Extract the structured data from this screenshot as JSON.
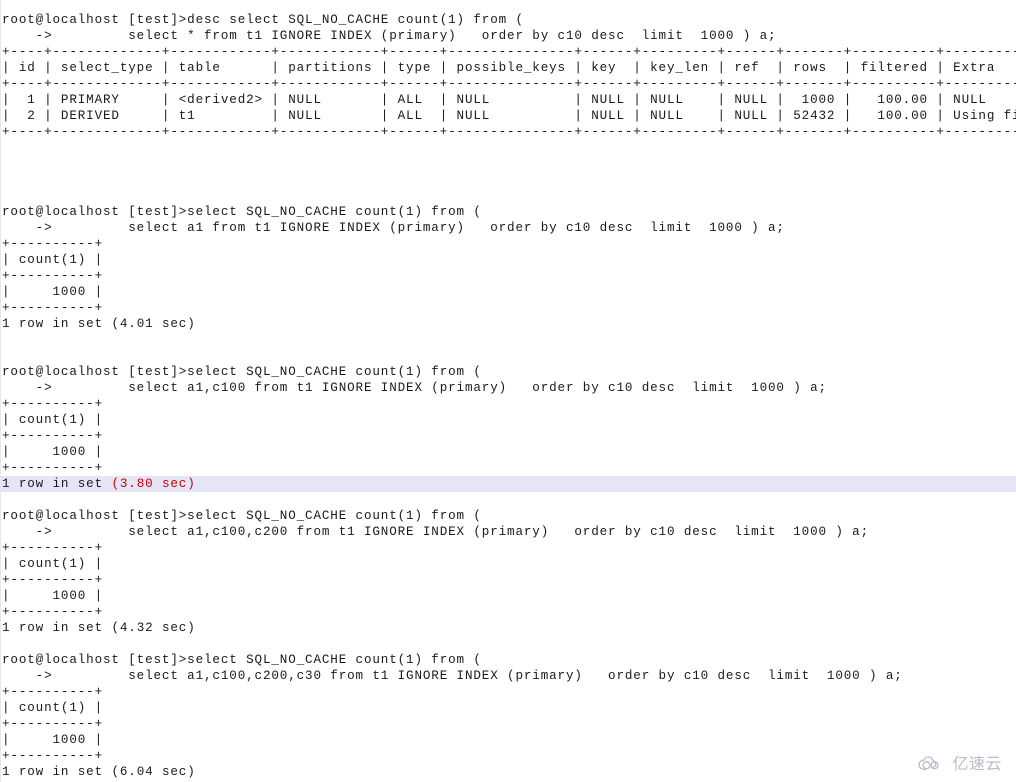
{
  "terminal": {
    "prompt": "root@localhost [test]>",
    "continuation": "    -> ",
    "colors": {
      "background": "#ffffff",
      "foreground": "#1a1a1a",
      "selection": "#e6e4f7",
      "error_red": "#cc0000",
      "watermark": "#8b93a8"
    }
  },
  "blocks": [
    {
      "id": "explain-block",
      "command_line_1": "root@localhost [test]>desc select SQL_NO_CACHE count(1) from (",
      "command_line_2": "    ->         select * from t1 IGNORE INDEX (primary)   order by c10 desc  limit  1000 ) a;",
      "table": {
        "separator": "+----+-------------+------------+------------+------+---------------+------+---------+------+-------+----------+----------------+",
        "header": "| id | select_type | table      | partitions | type | possible_keys | key  | key_len | ref  | rows  | filtered | Extra          |",
        "rows": [
          "|  1 | PRIMARY     | <derived2> | NULL       | ALL  | NULL          | NULL | NULL    | NULL |  1000 |   100.00 | NULL           |",
          "|  2 | DERIVED     | t1         | NULL       | ALL  | NULL          | NULL | NULL    | NULL | 52432 |   100.00 | Using filesort |"
        ],
        "columns": [
          "id",
          "select_type",
          "table",
          "partitions",
          "type",
          "possible_keys",
          "key",
          "key_len",
          "ref",
          "rows",
          "filtered",
          "Extra"
        ],
        "data": [
          {
            "id": "1",
            "select_type": "PRIMARY",
            "table": "<derived2>",
            "partitions": "NULL",
            "type": "ALL",
            "possible_keys": "NULL",
            "key": "NULL",
            "key_len": "NULL",
            "ref": "NULL",
            "rows": "1000",
            "filtered": "100.00",
            "Extra": "NULL"
          },
          {
            "id": "2",
            "select_type": "DERIVED",
            "table": "t1",
            "partitions": "NULL",
            "type": "ALL",
            "possible_keys": "NULL",
            "key": "NULL",
            "key_len": "NULL",
            "ref": "NULL",
            "rows": "52432",
            "filtered": "100.00",
            "Extra": "Using filesort"
          }
        ]
      }
    },
    {
      "id": "count-block-1",
      "command_line_1": "root@localhost [test]>select SQL_NO_CACHE count(1) from (",
      "command_line_2": "    ->         select a1 from t1 IGNORE INDEX (primary)   order by c10 desc  limit  1000 ) a;",
      "result_sep": "+----------+",
      "result_header": "| count(1) |",
      "result_row": "|     1000 |",
      "status": "1 row in set (4.01 sec)",
      "status_prefix": "1 row in set ",
      "status_time": "(4.01 sec)",
      "selected": false,
      "count_value": "1000",
      "elapsed_sec": "4.01"
    },
    {
      "id": "count-block-2",
      "command_line_1": "root@localhost [test]>select SQL_NO_CACHE count(1) from (",
      "command_line_2": "    ->         select a1,c100 from t1 IGNORE INDEX (primary)   order by c10 desc  limit  1000 ) a;",
      "result_sep": "+----------+",
      "result_header": "| count(1) |",
      "result_row": "|     1000 |",
      "status_prefix": "1 row in set ",
      "status_time": "(3.80 sec)",
      "selected": true,
      "count_value": "1000",
      "elapsed_sec": "3.80"
    },
    {
      "id": "count-block-3",
      "command_line_1": "root@localhost [test]>select SQL_NO_CACHE count(1) from (",
      "command_line_2": "    ->         select a1,c100,c200 from t1 IGNORE INDEX (primary)   order by c10 desc  limit  1000 ) a;",
      "result_sep": "+----------+",
      "result_header": "| count(1) |",
      "result_row": "|     1000 |",
      "status_prefix": "1 row in set ",
      "status_time": "(4.32 sec)",
      "selected": false,
      "count_value": "1000",
      "elapsed_sec": "4.32"
    },
    {
      "id": "count-block-4",
      "command_line_1": "root@localhost [test]>select SQL_NO_CACHE count(1) from (",
      "command_line_2": "    ->         select a1,c100,c200,c30 from t1 IGNORE INDEX (primary)   order by c10 desc  limit  1000 ) a;",
      "result_sep": "+----------+",
      "result_header": "| count(1) |",
      "result_row": "|     1000 |",
      "status_prefix": "1 row in set ",
      "status_time": "(6.04 sec)",
      "selected": false,
      "count_value": "1000",
      "elapsed_sec": "6.04"
    }
  ],
  "watermark": {
    "text": "亿速云",
    "icon": "cloud-icon"
  }
}
